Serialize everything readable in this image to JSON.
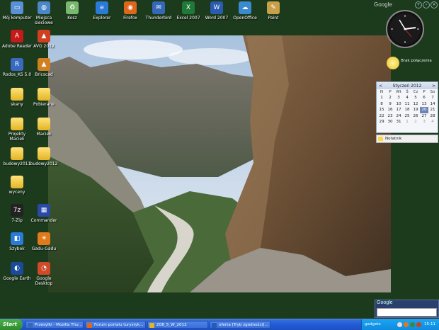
{
  "desktop_icons": [
    {
      "id": "moj-komputer",
      "label": "Mój komputer",
      "color": "#5b8fd6",
      "glyph": "▭"
    },
    {
      "id": "miejsca-sieciowe",
      "label": "Miejsca sieciowe",
      "color": "#4a86c8",
      "glyph": "◍"
    },
    {
      "id": "kosz",
      "label": "Kosz",
      "color": "#7ab870",
      "glyph": "♻"
    },
    {
      "id": "explorer",
      "label": "Explorer",
      "color": "#2a7ad8",
      "glyph": "e"
    },
    {
      "id": "firefox",
      "label": "Firefox",
      "color": "#e0661c",
      "glyph": "◉"
    },
    {
      "id": "thunderbird",
      "label": "Thunderbird",
      "color": "#3568b8",
      "glyph": "✉"
    },
    {
      "id": "excel",
      "label": "Excel 2007",
      "color": "#1f7a3a",
      "glyph": "X"
    },
    {
      "id": "word",
      "label": "Word 2007",
      "color": "#2a5bb0",
      "glyph": "W"
    },
    {
      "id": "openoffice",
      "label": "OpenOffice",
      "color": "#3a8ad0",
      "glyph": "☁"
    },
    {
      "id": "paint",
      "label": "Paint",
      "color": "#c8a048",
      "glyph": "✎"
    },
    {
      "id": "adobe-reader",
      "label": "Adobe Reader",
      "color": "#c41a1a",
      "glyph": "A"
    },
    {
      "id": "avg",
      "label": "AVG 2012",
      "color": "#d04020",
      "glyph": "▲"
    },
    {
      "id": "rodos",
      "label": "Rodos_KS 5.0",
      "color": "#3a6ac0",
      "glyph": "R"
    },
    {
      "id": "bricscad",
      "label": "Bricscad",
      "color": "#d08020",
      "glyph": "▲"
    },
    {
      "id": "skany",
      "label": "skany",
      "color": "folder",
      "glyph": ""
    },
    {
      "id": "pobierane",
      "label": "Pobierane",
      "color": "folder",
      "glyph": ""
    },
    {
      "id": "projekty",
      "label": "Projekty Maciek",
      "color": "folder",
      "glyph": ""
    },
    {
      "id": "maciek",
      "label": "Maciek",
      "color": "folder",
      "glyph": ""
    },
    {
      "id": "budowy2011",
      "label": "budowy2011",
      "color": "folder",
      "glyph": ""
    },
    {
      "id": "budowy2012",
      "label": "budowy2012",
      "color": "folder",
      "glyph": ""
    },
    {
      "id": "wycena",
      "label": "wyceny",
      "color": "folder",
      "glyph": ""
    },
    {
      "id": "7zip",
      "label": "7-Zip",
      "color": "#222",
      "glyph": "7z"
    },
    {
      "id": "commander",
      "label": "Commander",
      "color": "#2a4aa8",
      "glyph": "▦"
    },
    {
      "id": "szybok",
      "label": "Szybok",
      "color": "#2a7ad8",
      "glyph": "◧"
    },
    {
      "id": "gadu-gadu",
      "label": "Gadu-Gadu",
      "color": "#e07a1a",
      "glyph": "☀"
    },
    {
      "id": "google-earth",
      "label": "Google Earth",
      "color": "#1a4a9a",
      "glyph": "◐"
    },
    {
      "id": "google-desktop",
      "label": "Google Desktop",
      "color": "#d04a2a",
      "glyph": "◔"
    }
  ],
  "sidebar": {
    "google_label": "Google",
    "clock_label": "",
    "weather_text": "Brak połączenia",
    "calendar": {
      "month_title": "Styczeń 2012",
      "prev": "<",
      "next": ">",
      "day_names": [
        "N",
        "P",
        "Wt",
        "Ś",
        "Cz",
        "P",
        "So"
      ],
      "weeks": [
        [
          "1",
          "2",
          "3",
          "4",
          "5",
          "6",
          "7"
        ],
        [
          "8",
          "9",
          "10",
          "11",
          "12",
          "13",
          "14"
        ],
        [
          "15",
          "16",
          "17",
          "18",
          "19",
          "20",
          "21"
        ],
        [
          "22",
          "23",
          "24",
          "25",
          "26",
          "27",
          "28"
        ],
        [
          "29",
          "30",
          "31",
          "1",
          "2",
          "3",
          "4"
        ]
      ],
      "today": "20"
    },
    "notes_label": "Notatnik",
    "search_label": "Google"
  },
  "taskbar": {
    "start_label": "Start",
    "buttons": [
      {
        "label": "Przesyłki - Mozilla Thu...",
        "color": "#3568b8"
      },
      {
        "label": "Forum portalu turystyk...",
        "color": "#e0661c"
      },
      {
        "label": "Z08_5_W_2012",
        "color": "#e3b424"
      },
      {
        "label": "oferta [Tryb zgodności]...",
        "color": "#2a5bb0"
      }
    ],
    "tray_label": "gadgets",
    "time": "15:11"
  }
}
